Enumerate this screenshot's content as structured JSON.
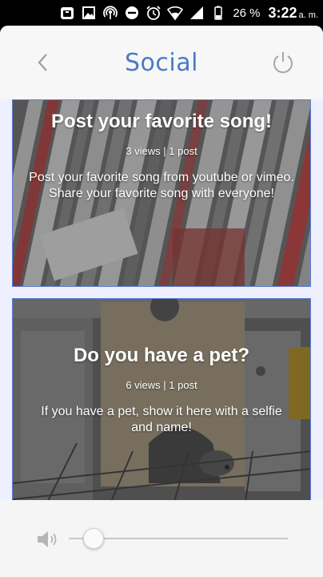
{
  "status_bar": {
    "battery_percent": "26 %",
    "time": "3:22",
    "ampm": "a. m.",
    "icons": [
      "briefcase-icon",
      "image-icon",
      "hotspot-icon",
      "do-not-disturb-icon",
      "alarm-icon",
      "wifi-icon",
      "signal-icon",
      "battery-icon"
    ]
  },
  "header": {
    "title": "Social",
    "back_icon": "chevron-left-icon",
    "power_icon": "power-icon"
  },
  "posts": [
    {
      "title": "Post your favorite song!",
      "meta": "3 views | 1 post",
      "description": "Post your favorite song from youtube or vimeo. Share your favorite song with everyone!"
    },
    {
      "title": "Do you have a pet?",
      "meta": "6 views | 1 post",
      "description": "If you have a pet, show it here with a selfie and name!"
    }
  ],
  "player": {
    "volume_icon": "volume-icon",
    "volume_level_percent": 10
  },
  "colors": {
    "accent": "#4a7bc4",
    "card_border": "#5b7fd6",
    "background": "#eef0ff"
  }
}
